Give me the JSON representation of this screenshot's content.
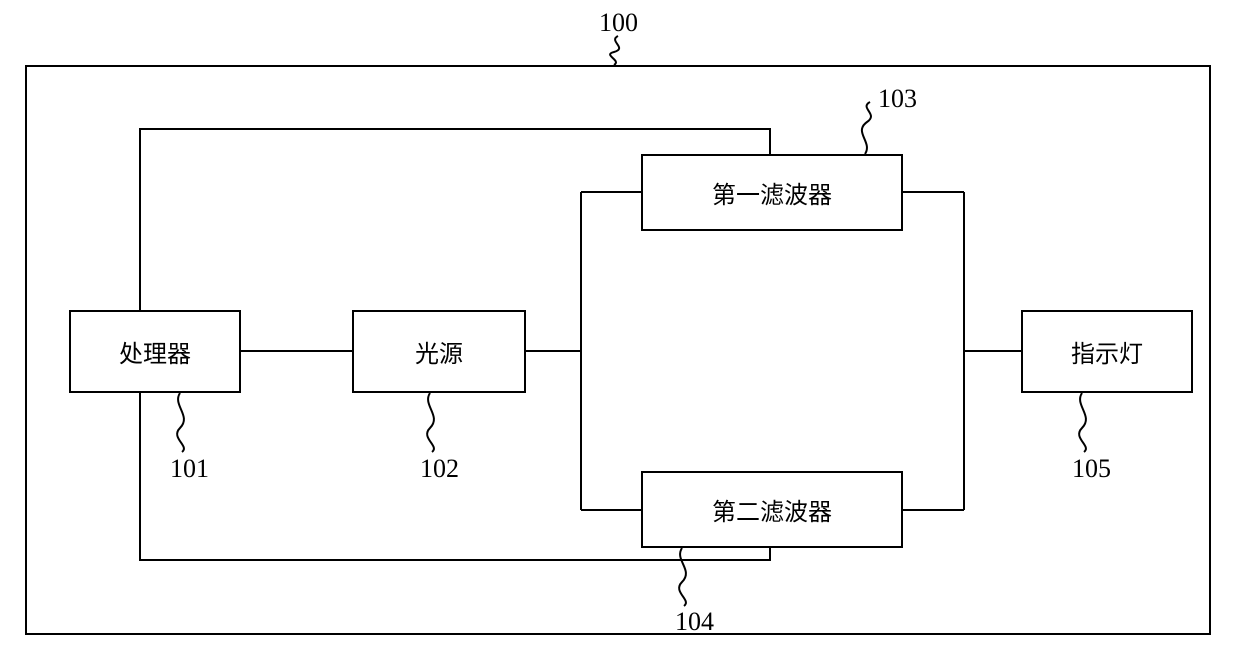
{
  "diagram": {
    "overall_ref": "100",
    "blocks": {
      "processor": {
        "label": "处理器",
        "ref": "101"
      },
      "light_source": {
        "label": "光源",
        "ref": "102"
      },
      "filter1": {
        "label": "第一滤波器",
        "ref": "103"
      },
      "filter2": {
        "label": "第二滤波器",
        "ref": "104"
      },
      "indicator": {
        "label": "指示灯",
        "ref": "105"
      }
    }
  }
}
